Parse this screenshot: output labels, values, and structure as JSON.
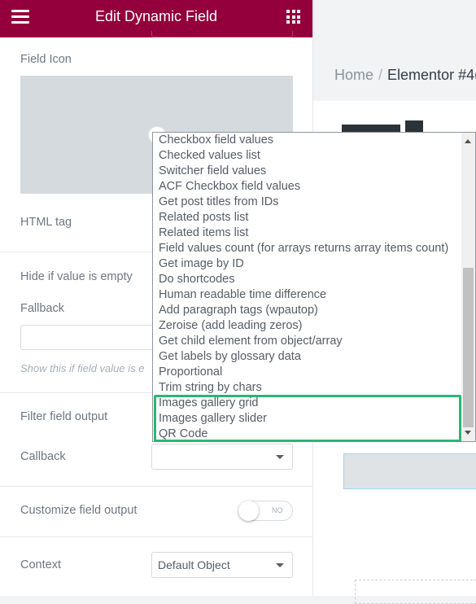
{
  "header": {
    "title": "Edit Dynamic Field"
  },
  "panel": {
    "field_icon_label": "Field Icon",
    "html_tag_label": "HTML tag",
    "hide_if_empty_label": "Hide if value is empty",
    "fallback_label": "Fallback",
    "fallback_value": "",
    "fallback_hint": "Show this if field value is e",
    "filter_output_label": "Filter field output",
    "callback_label": "Callback",
    "callback_value": "",
    "customize_output_label": "Customize field output",
    "customize_toggle_text": "NO",
    "context_label": "Context",
    "context_value": "Default Object"
  },
  "preview": {
    "breadcrumb_home": "Home",
    "breadcrumb_separator": "/",
    "breadcrumb_current": "Elementor #4("
  },
  "dropdown": {
    "items": [
      "Checkbox field values",
      "Checked values list",
      "Switcher field values",
      "ACF Checkbox field values",
      "Get post titles from IDs",
      "Related posts list",
      "Related items list",
      "Field values count (for arrays returns array items count)",
      "Get image by ID",
      "Do shortcodes",
      "Human readable time difference",
      "Add paragraph tags (wpautop)",
      "Zeroise (add leading zeros)",
      "Get child element from object/array",
      "Get labels by glossary data",
      "Proportional",
      "Trim string by chars",
      "Images gallery grid",
      "Images gallery slider",
      "QR Code"
    ],
    "highlighted_items": [
      "Images gallery grid",
      "Images gallery slider",
      "QR Code"
    ]
  },
  "colors": {
    "header_bg": "#93003c",
    "highlight_border": "#2bb673"
  }
}
